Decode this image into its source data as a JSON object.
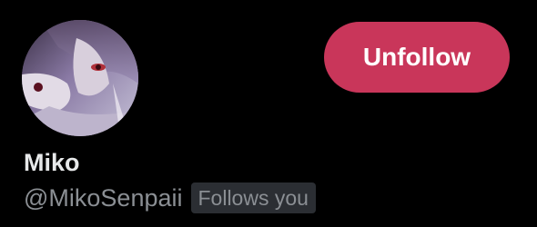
{
  "profile": {
    "display_name": "Miko",
    "handle": "@MikoSenpaii",
    "follows_you_badge": "Follows you",
    "avatar": "avatar-anime-illustration"
  },
  "actions": {
    "unfollow_label": "Unfollow"
  },
  "colors": {
    "background": "#000000",
    "unfollow_button": "#c9365a",
    "name_text": "#e7e9ea",
    "secondary_text": "#8b8f94",
    "badge_background": "#2b2e33"
  }
}
